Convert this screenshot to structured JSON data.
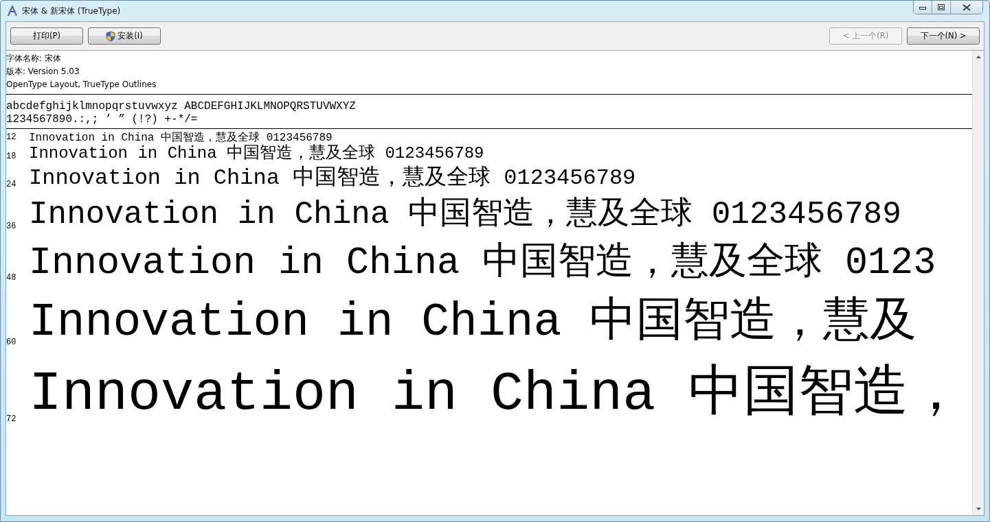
{
  "window": {
    "title": "宋体 & 新宋体 (TrueType)"
  },
  "toolbar": {
    "actions": [
      {
        "label": "打印(P)",
        "kind": "plain",
        "disabled": false
      },
      {
        "label": "安装(I)",
        "kind": "shield",
        "disabled": false
      }
    ],
    "navigation": [
      {
        "label": "< 上一个(R)",
        "disabled": true
      },
      {
        "label": "下一个(N) >",
        "disabled": false
      }
    ]
  },
  "info": [
    "字体名称: 宋体",
    "版本: Version 5.03",
    "OpenType Layout, TrueType Outlines"
  ],
  "charset": [
    "abcdefghijklmnopqrstuvwxyz ABCDEFGHIJKLMNOPQRSTUVWXYZ",
    "1234567890.:,; ’ ” (!?) +-*/="
  ],
  "samples": [
    {
      "size": "12",
      "text": "Innovation in China 中国智造，慧及全球 0123456789"
    },
    {
      "size": "18",
      "text": "Innovation in China 中国智造，慧及全球 0123456789"
    },
    {
      "size": "24",
      "text": "Innovation in China 中国智造，慧及全球 0123456789"
    },
    {
      "size": "36",
      "text": "Innovation in China 中国智造，慧及全球 0123456789"
    },
    {
      "size": "48",
      "text": "Innovation in China 中国智造，慧及全球 0123"
    },
    {
      "size": "60",
      "text": "Innovation in China 中国智造，慧及"
    },
    {
      "size": "72",
      "text": "Innovation in China 中国智造，"
    }
  ]
}
